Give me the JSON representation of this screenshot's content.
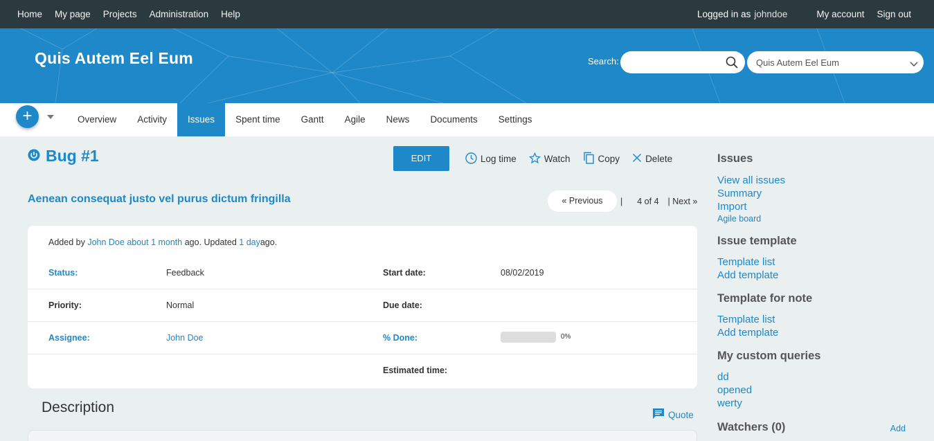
{
  "topbar": {
    "menu": [
      "Home",
      "My page",
      "Projects",
      "Administration",
      "Help"
    ],
    "logged_in_label": "Logged in as",
    "username": "johndoe",
    "my_account": "My account",
    "sign_out": "Sign out"
  },
  "header": {
    "project_title": "Quis Autem Eel Eum",
    "search_label": "Search:",
    "search_value": "",
    "project_select_value": "Quis Autem Eel Eum"
  },
  "mainnav": {
    "new_button": "+",
    "tabs": [
      "Overview",
      "Activity",
      "Issues",
      "Spent time",
      "Gantt",
      "Agile",
      "News",
      "Documents",
      "Settings"
    ],
    "active_tab": "Issues"
  },
  "issue": {
    "title": "Bug #1",
    "subject": "Aenean consequat justo vel purus dictum fringilla",
    "edit_label": "EDIT",
    "actions": {
      "log_time": "Log time",
      "watch": "Watch",
      "copy": "Copy",
      "delete": "Delete"
    },
    "pager": {
      "previous": "« Previous",
      "separator": "|",
      "count": "4 of 4",
      "next": "| Next »"
    },
    "author_line": {
      "added_by": "Added by",
      "author": "John Doe",
      "added_ago": "about 1 month",
      "ago_updated": "ago. Updated",
      "updated_ago": "1 day",
      "ago_end": "ago."
    },
    "fields": {
      "status_label": "Status:",
      "status_value": "Feedback",
      "start_date_label": "Start date:",
      "start_date_value": "08/02/2019",
      "priority_label": "Priority:",
      "priority_value": "Normal",
      "due_date_label": "Due date:",
      "due_date_value": "",
      "assignee_label": "Assignee:",
      "assignee_value": "John Doe",
      "done_label": "% Done:",
      "done_value": "0%",
      "done_fraction": 0,
      "estimated_label": "Estimated time:",
      "estimated_value": ""
    },
    "description_title": "Description",
    "quote_label": "Quote"
  },
  "sidebar": {
    "issues_title": "Issues",
    "issues_links": [
      "View all issues",
      "Summary",
      "Import"
    ],
    "agile_board": "Agile board",
    "issue_template_title": "Issue template",
    "issue_template_links": [
      "Template list",
      "Add template"
    ],
    "note_template_title": "Template for note",
    "note_template_links": [
      "Template list",
      "Add template"
    ],
    "queries_title": "My custom queries",
    "queries": [
      "dd",
      "opened",
      "werty"
    ],
    "watchers_title": "Watchers (0)",
    "watchers_add": "Add"
  },
  "colors": {
    "accent": "#1e88c9",
    "topbar": "#2b3a3f",
    "background": "#eaeff0"
  }
}
